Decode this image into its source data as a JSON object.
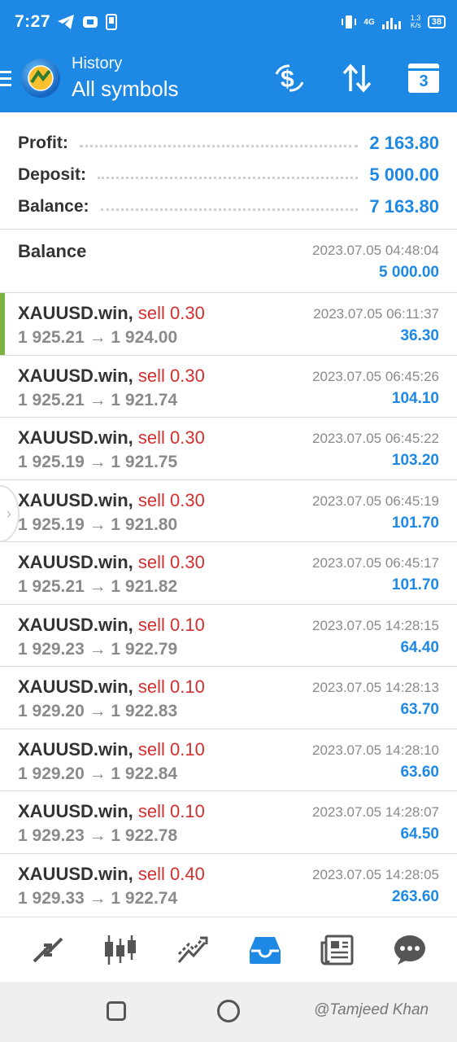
{
  "status_bar": {
    "time": "7:27",
    "net_speed": "1.3\nK/s",
    "net_type": "4G",
    "battery": "38"
  },
  "header": {
    "subtitle": "History",
    "title": "All symbols",
    "calendar_day": "3"
  },
  "summary": {
    "profit_label": "Profit:",
    "profit_value": "2 163.80",
    "deposit_label": "Deposit:",
    "deposit_value": "5 000.00",
    "balance_label": "Balance:",
    "balance_value": "7 163.80"
  },
  "balance_entry": {
    "label": "Balance",
    "date": "2023.07.05 04:48:04",
    "amount": "5 000.00"
  },
  "trades": [
    {
      "symbol": "XAUUSD.win,",
      "side": "sell 0.30",
      "prices": "1 925.21 → 1 924.00",
      "date": "2023.07.05 06:11:37",
      "profit": "36.30"
    },
    {
      "symbol": "XAUUSD.win,",
      "side": "sell 0.30",
      "prices": "1 925.21 → 1 921.74",
      "date": "2023.07.05 06:45:26",
      "profit": "104.10"
    },
    {
      "symbol": "XAUUSD.win,",
      "side": "sell 0.30",
      "prices": "1 925.19 → 1 921.75",
      "date": "2023.07.05 06:45:22",
      "profit": "103.20"
    },
    {
      "symbol": "XAUUSD.win,",
      "side": "sell 0.30",
      "prices": "1 925.19 → 1 921.80",
      "date": "2023.07.05 06:45:19",
      "profit": "101.70"
    },
    {
      "symbol": "XAUUSD.win,",
      "side": "sell 0.30",
      "prices": "1 925.21 → 1 921.82",
      "date": "2023.07.05 06:45:17",
      "profit": "101.70"
    },
    {
      "symbol": "XAUUSD.win,",
      "side": "sell 0.10",
      "prices": "1 929.23 → 1 922.79",
      "date": "2023.07.05 14:28:15",
      "profit": "64.40"
    },
    {
      "symbol": "XAUUSD.win,",
      "side": "sell 0.10",
      "prices": "1 929.20 → 1 922.83",
      "date": "2023.07.05 14:28:13",
      "profit": "63.70"
    },
    {
      "symbol": "XAUUSD.win,",
      "side": "sell 0.10",
      "prices": "1 929.20 → 1 922.84",
      "date": "2023.07.05 14:28:10",
      "profit": "63.60"
    },
    {
      "symbol": "XAUUSD.win,",
      "side": "sell 0.10",
      "prices": "1 929.23 → 1 922.78",
      "date": "2023.07.05 14:28:07",
      "profit": "64.50"
    },
    {
      "symbol": "XAUUSD.win,",
      "side": "sell 0.40",
      "prices": "1 929.33 → 1 922.74",
      "date": "2023.07.05 14:28:05",
      "profit": "263.60"
    }
  ],
  "bottom_nav": [
    "quotes-icon",
    "chart-icon",
    "trade-icon",
    "history-icon",
    "news-icon",
    "chat-icon"
  ],
  "watermark": "@Tamjeed Khan",
  "colors": {
    "accent": "#1e88e5",
    "sell": "#d32f2f",
    "marker": "#7cb342"
  }
}
